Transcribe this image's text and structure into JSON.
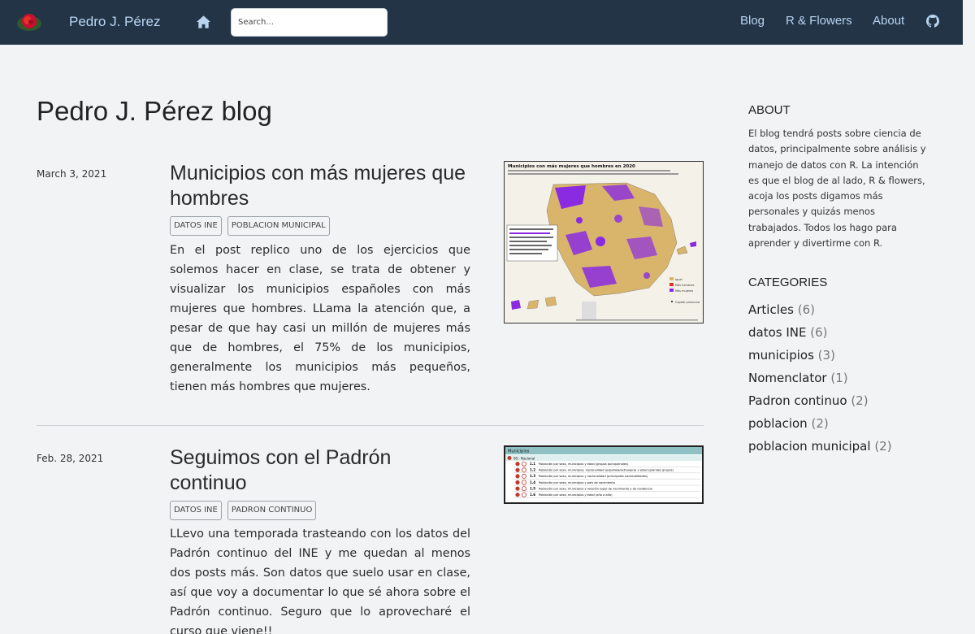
{
  "nav": {
    "brand": "Pedro J. Pérez",
    "search_placeholder": "Search...",
    "links": [
      "Blog",
      "R & Flowers",
      "About"
    ],
    "icons": [
      "rose-logo",
      "home-icon",
      "github-icon"
    ]
  },
  "main": {
    "page_title": "Pedro J. Pérez blog",
    "posts": [
      {
        "date": "March 3, 2021",
        "title": "Municipios con más mujeres que hombres",
        "tags": [
          "DATOS INE",
          "POBLACION MUNICIPAL"
        ],
        "excerpt": "En el post replico uno de los ejercicios que solemos hacer en clase, se trata de obtener y visualizar los municipios españoles con más mujeres que hombres. LLama la atención que, a pesar de que hay casi un millón de mujeres más que de hombres, el 75% de los municipios, generalmente los municipios más pequeños, tienen más hombres que mujeres.",
        "thumb": {
          "title": "Municipios con más mujeres que hombres en 2020",
          "legend": [
            "Igual",
            "Más hombres",
            "Más mujeres"
          ],
          "note": "Capital provincial"
        }
      },
      {
        "date": "Feb. 28, 2021",
        "title": "Seguimos con el Padrón continuo",
        "tags": [
          "DATOS INE",
          "PADRON CONTINUO"
        ],
        "excerpt": "LLevo una temporada trasteando con los datos del Padrón continuo del INE y me quedan al menos dos posts más. Son datos que suelo usar en clase, así que voy a documentar lo que sé ahora sobre el Padrón continuo. Seguro que lo aprovecharé el curso que viene!!",
        "thumb": {
          "header": "Municipios",
          "section": "00.- Nacional",
          "rows": [
            {
              "num": "1.1",
              "text": "Población por sexo, municipios y edad (grupos quinquenales)"
            },
            {
              "num": "1.2",
              "text": "Población por sexo, municipios, nacionalidad (española/extranjera) y edad (grandes grupos)"
            },
            {
              "num": "1.3",
              "text": "Población por sexo, municipios y nacionalidad (principales nacionalidades)"
            },
            {
              "num": "1.4",
              "text": "Población por sexo, municipios y país de nacimiento"
            },
            {
              "num": "1.5",
              "text": "Población por sexo, municipios y relación lugar de nacimiento y de residencia"
            },
            {
              "num": "1.6",
              "text": "Población por sexo, municipios y edad (año a año)"
            }
          ]
        }
      }
    ]
  },
  "sidebar": {
    "about_heading": "ABOUT",
    "about_text": "El blog tendrá posts sobre ciencia de datos, principalmente sobre análisis y manejo de datos con R. La intención es que el blog de al lado, R & flowers, acoja los posts digamos más personales y quizás menos trabajados. Todos los hago para aprender y divertirme con R.",
    "categories_heading": "CATEGORIES",
    "categories": [
      {
        "name": "Articles",
        "count": "(6)"
      },
      {
        "name": "datos INE",
        "count": "(6)"
      },
      {
        "name": "municipios",
        "count": "(3)"
      },
      {
        "name": "Nomenclator",
        "count": "(1)"
      },
      {
        "name": "Padron continuo",
        "count": "(2)"
      },
      {
        "name": "poblacion",
        "count": "(2)"
      },
      {
        "name": "poblacion municipal",
        "count": "(2)"
      }
    ]
  },
  "colors": {
    "navbar": "#243447",
    "nav_text": "#b8d4f0",
    "background": "#f1f3f4",
    "map_tan": "#d9b56c",
    "map_purple": "#8a2be2",
    "map_red": "#e8302a"
  }
}
